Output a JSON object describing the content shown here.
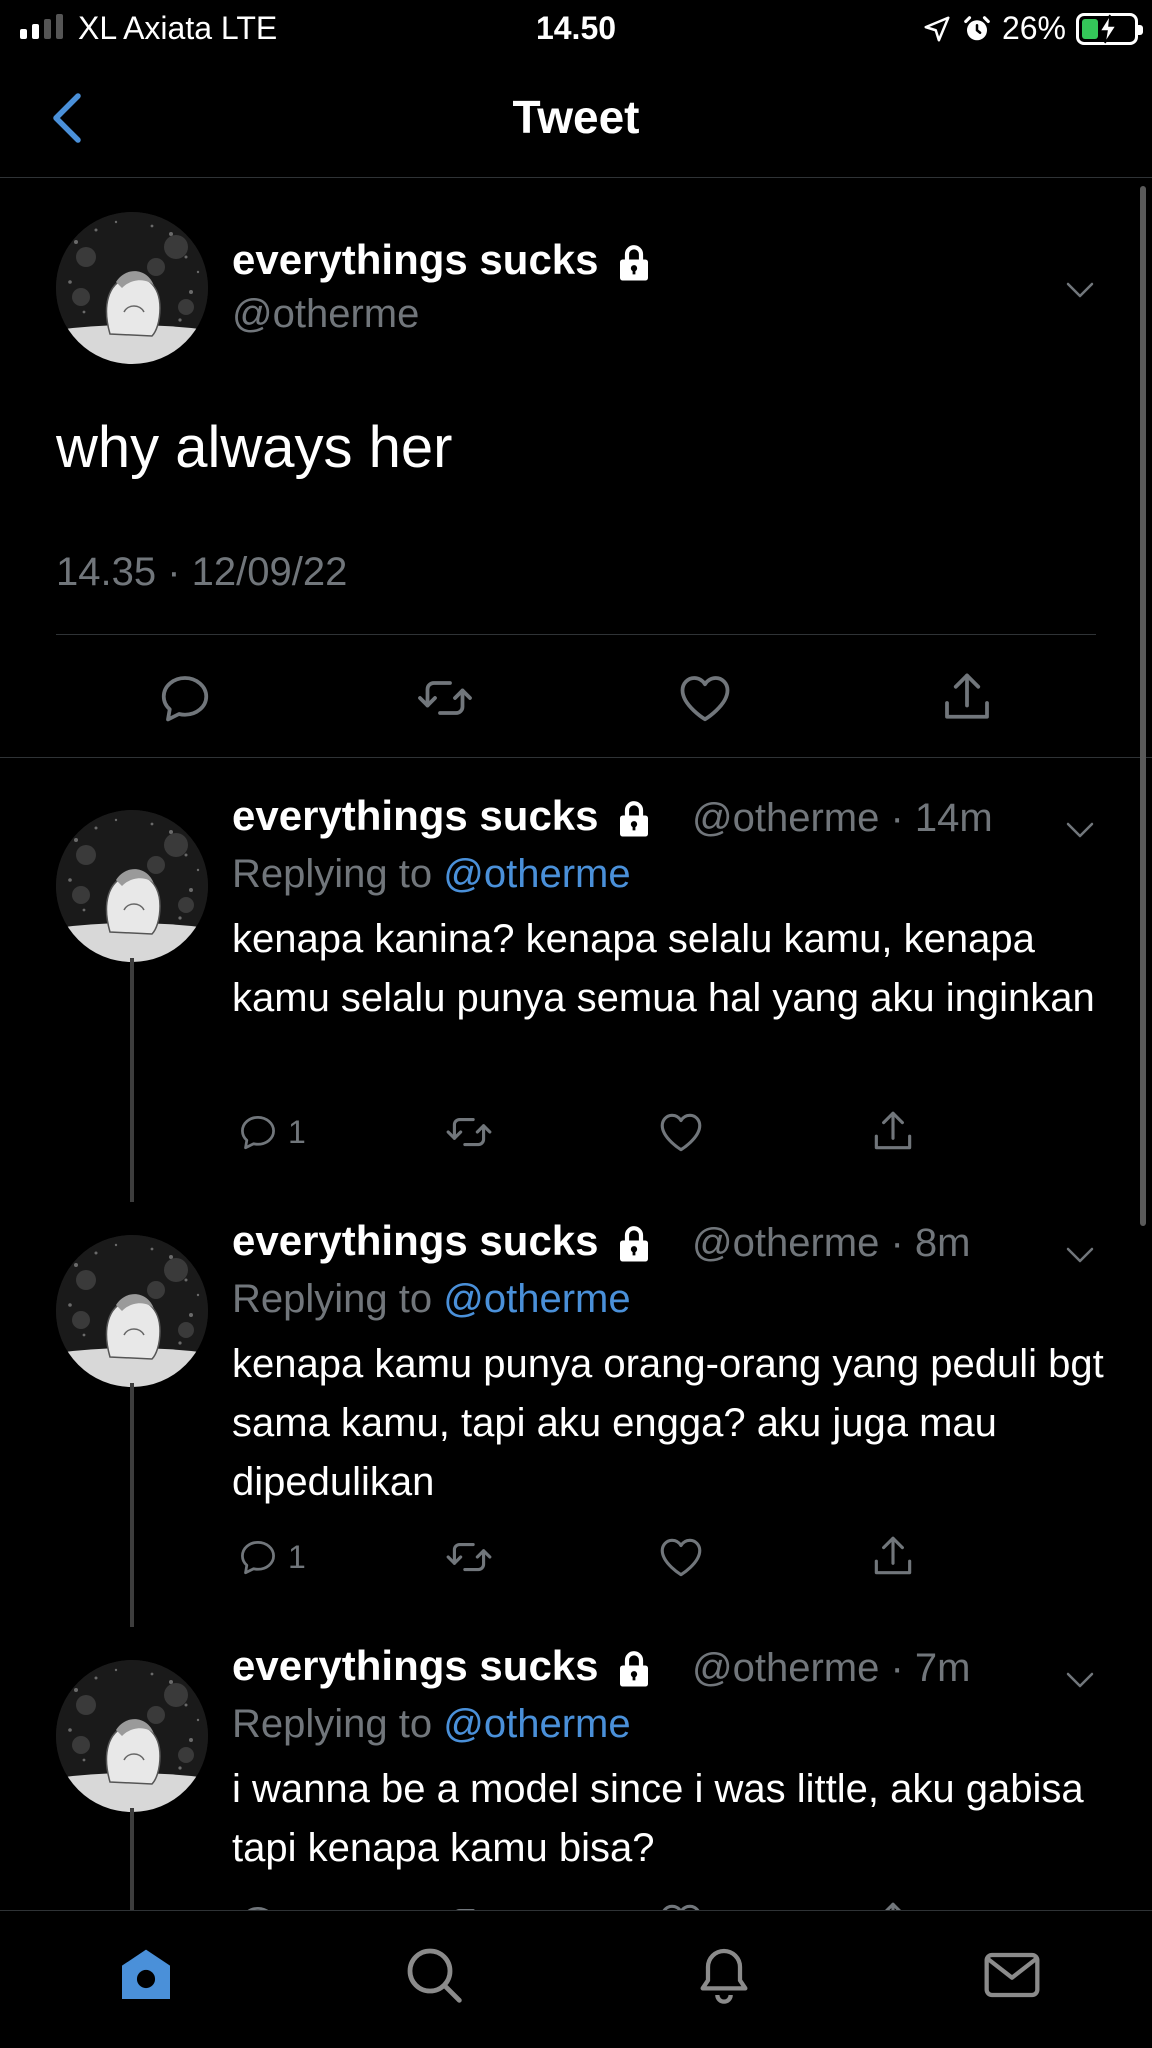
{
  "status_bar": {
    "carrier": "XL Axiata  LTE",
    "time": "14.50",
    "battery": "26%",
    "icons": [
      "signal-icon",
      "location-arrow-icon",
      "alarm-icon",
      "battery-charging-icon"
    ]
  },
  "header": {
    "title": "Tweet",
    "back_icon": "chevron-left-icon"
  },
  "main_tweet": {
    "name": "everythings sucks",
    "handle": "@otherme",
    "text": "why always her",
    "timestamp": "14.35 · 12/09/22",
    "actions": [
      "reply-icon",
      "retweet-icon",
      "like-icon",
      "share-icon"
    ]
  },
  "replies": [
    {
      "name": "everythings sucks",
      "meta": "@otherme · 14m",
      "replying_prefix": "Replying to",
      "replying_to": "@otherme",
      "text": "kenapa kanina? kenapa selalu kamu, kenapa kamu selalu punya semua hal yang aku inginkan",
      "reply_count": "1"
    },
    {
      "name": "everythings sucks",
      "meta": "@otherme · 8m",
      "replying_prefix": "Replying to",
      "replying_to": "@otherme",
      "text": "kenapa kamu punya orang-orang yang peduli bgt sama kamu, tapi aku engga? aku juga mau dipedulikan",
      "reply_count": "1"
    },
    {
      "name": "everythings sucks",
      "meta": "@otherme · 7m",
      "replying_prefix": "Replying to",
      "replying_to": "@otherme",
      "text": "i wanna be a model since i was little, aku gabisa tapi kenapa kamu bisa?",
      "reply_count": ""
    }
  ],
  "tab_bar": {
    "tabs": [
      "home-icon",
      "search-icon",
      "notifications-icon",
      "messages-icon"
    ],
    "active": "home-icon"
  },
  "colors": {
    "background": "#000000",
    "accent": "#4a90d9",
    "secondary_text": "#71767b",
    "divider": "#2f3336"
  }
}
